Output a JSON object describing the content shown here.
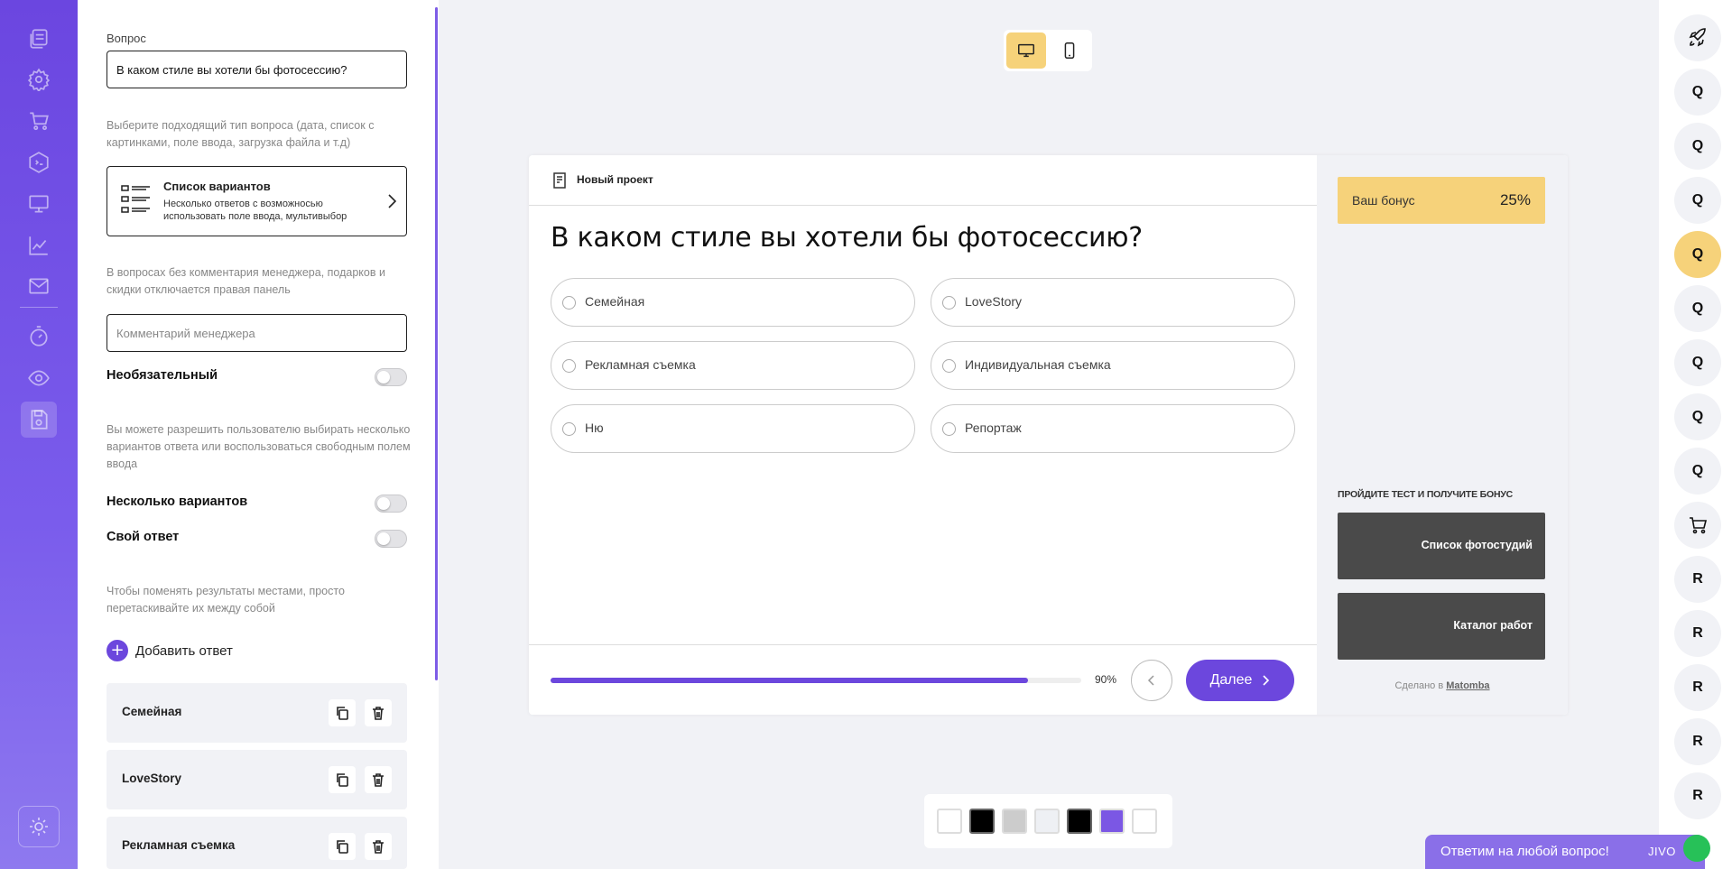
{
  "editor": {
    "question_label": "Вопрос",
    "question_value": "В каком стиле вы хотели бы фотосессию?",
    "type_hint": "Выберите подходящий тип вопроса (дата, список с картинками, поле ввода, загрузка файла и т.д)",
    "type_card": {
      "title": "Список вариантов",
      "description": "Несколько ответов с возможносью использовать поле ввода, мультивыбор"
    },
    "comment_hint": "В вопросах без комментария менеджера, подарков и скидки отключается правая панель",
    "comment_placeholder": "Комментарий менеджера",
    "optional_label": "Необязательный",
    "multi_hint": "Вы можете разрешить пользователю выбирать несколько вариантов ответа или воспользоваться свободным полем ввода",
    "multiple_label": "Несколько вариантов",
    "own_answer_label": "Свой ответ",
    "reorder_hint": "Чтобы поменять результаты местами, просто перетаскивайте их между собой",
    "add_answer_label": "Добавить ответ",
    "answers": [
      "Семейная",
      "LoveStory",
      "Рекламная съемка"
    ]
  },
  "preview": {
    "project_name": "Новый проект",
    "question": "В каком стиле вы хотели бы фотосессию?",
    "options": [
      "Семейная",
      "LoveStory",
      "Рекламная съемка",
      "Индивидуальная съемка",
      "Ню",
      "Репортаж"
    ],
    "progress_fraction": 0.9,
    "progress_label": "90%",
    "next_label": "Далее",
    "bonus_label": "Ваш бонус",
    "bonus_value": "25%",
    "side_title": "ПРОЙДИТЕ ТЕСТ И ПОЛУЧИТЕ БОНУС",
    "side_buttons": [
      "Список фотостудий",
      "Каталог работ"
    ],
    "made_by_prefix": "Сделано в",
    "made_by_brand": "Matomba"
  },
  "palette": {
    "swatches": [
      "#ffffff",
      "#000000",
      "#cccccc",
      "#eef0f4",
      "#000000",
      "#7b57e4",
      "#ffffff"
    ]
  },
  "steps": {
    "items": [
      "rocket-icon",
      "Q",
      "Q",
      "Q",
      "Q",
      "Q",
      "Q",
      "Q",
      "Q",
      "cart-icon",
      "R",
      "R",
      "R",
      "R",
      "R"
    ],
    "current_index": 4
  },
  "chat": {
    "text": "Ответим на любой вопрос!",
    "brand": "JIVO"
  },
  "colors": {
    "accent": "#6c47dd",
    "bonus": "#f6d27a",
    "dark_button": "#4a4a4a"
  }
}
